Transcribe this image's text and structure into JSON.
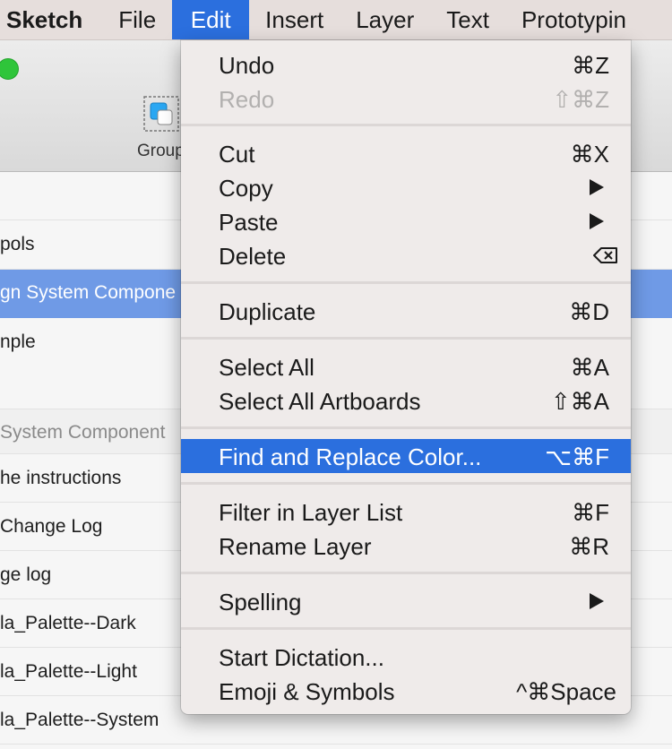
{
  "menubar": {
    "app": "Sketch",
    "items": [
      "File",
      "Edit",
      "Insert",
      "Layer",
      "Text",
      "Prototypin"
    ]
  },
  "toolbar": {
    "group_label": "Group"
  },
  "layers": [
    "pols",
    "gn System Compone",
    "nple",
    "System Component",
    "he instructions",
    "Change Log",
    "ge log",
    "la_Palette--Dark",
    "la_Palette--Light",
    "la_Palette--System"
  ],
  "menu": {
    "undo": {
      "label": "Undo",
      "shortcut": "⌘Z"
    },
    "redo": {
      "label": "Redo",
      "shortcut": "⇧⌘Z"
    },
    "cut": {
      "label": "Cut",
      "shortcut": "⌘X"
    },
    "copy": {
      "label": "Copy"
    },
    "paste": {
      "label": "Paste"
    },
    "delete": {
      "label": "Delete"
    },
    "duplicate": {
      "label": "Duplicate",
      "shortcut": "⌘D"
    },
    "select_all": {
      "label": "Select All",
      "shortcut": "⌘A"
    },
    "select_all_artboards": {
      "label": "Select All Artboards",
      "shortcut": "⇧⌘A"
    },
    "find_replace": {
      "label": "Find and Replace Color...",
      "shortcut": "⌥⌘F"
    },
    "filter": {
      "label": "Filter in Layer List",
      "shortcut": "⌘F"
    },
    "rename": {
      "label": "Rename Layer",
      "shortcut": "⌘R"
    },
    "spelling": {
      "label": "Spelling"
    },
    "dictation": {
      "label": "Start Dictation..."
    },
    "emoji": {
      "label": "Emoji & Symbols",
      "shortcut": "^⌘Space"
    }
  },
  "colors": {
    "accent": "#2b6fde",
    "selection": "#6f9ae6",
    "traffic_green": "#2fc53a"
  }
}
